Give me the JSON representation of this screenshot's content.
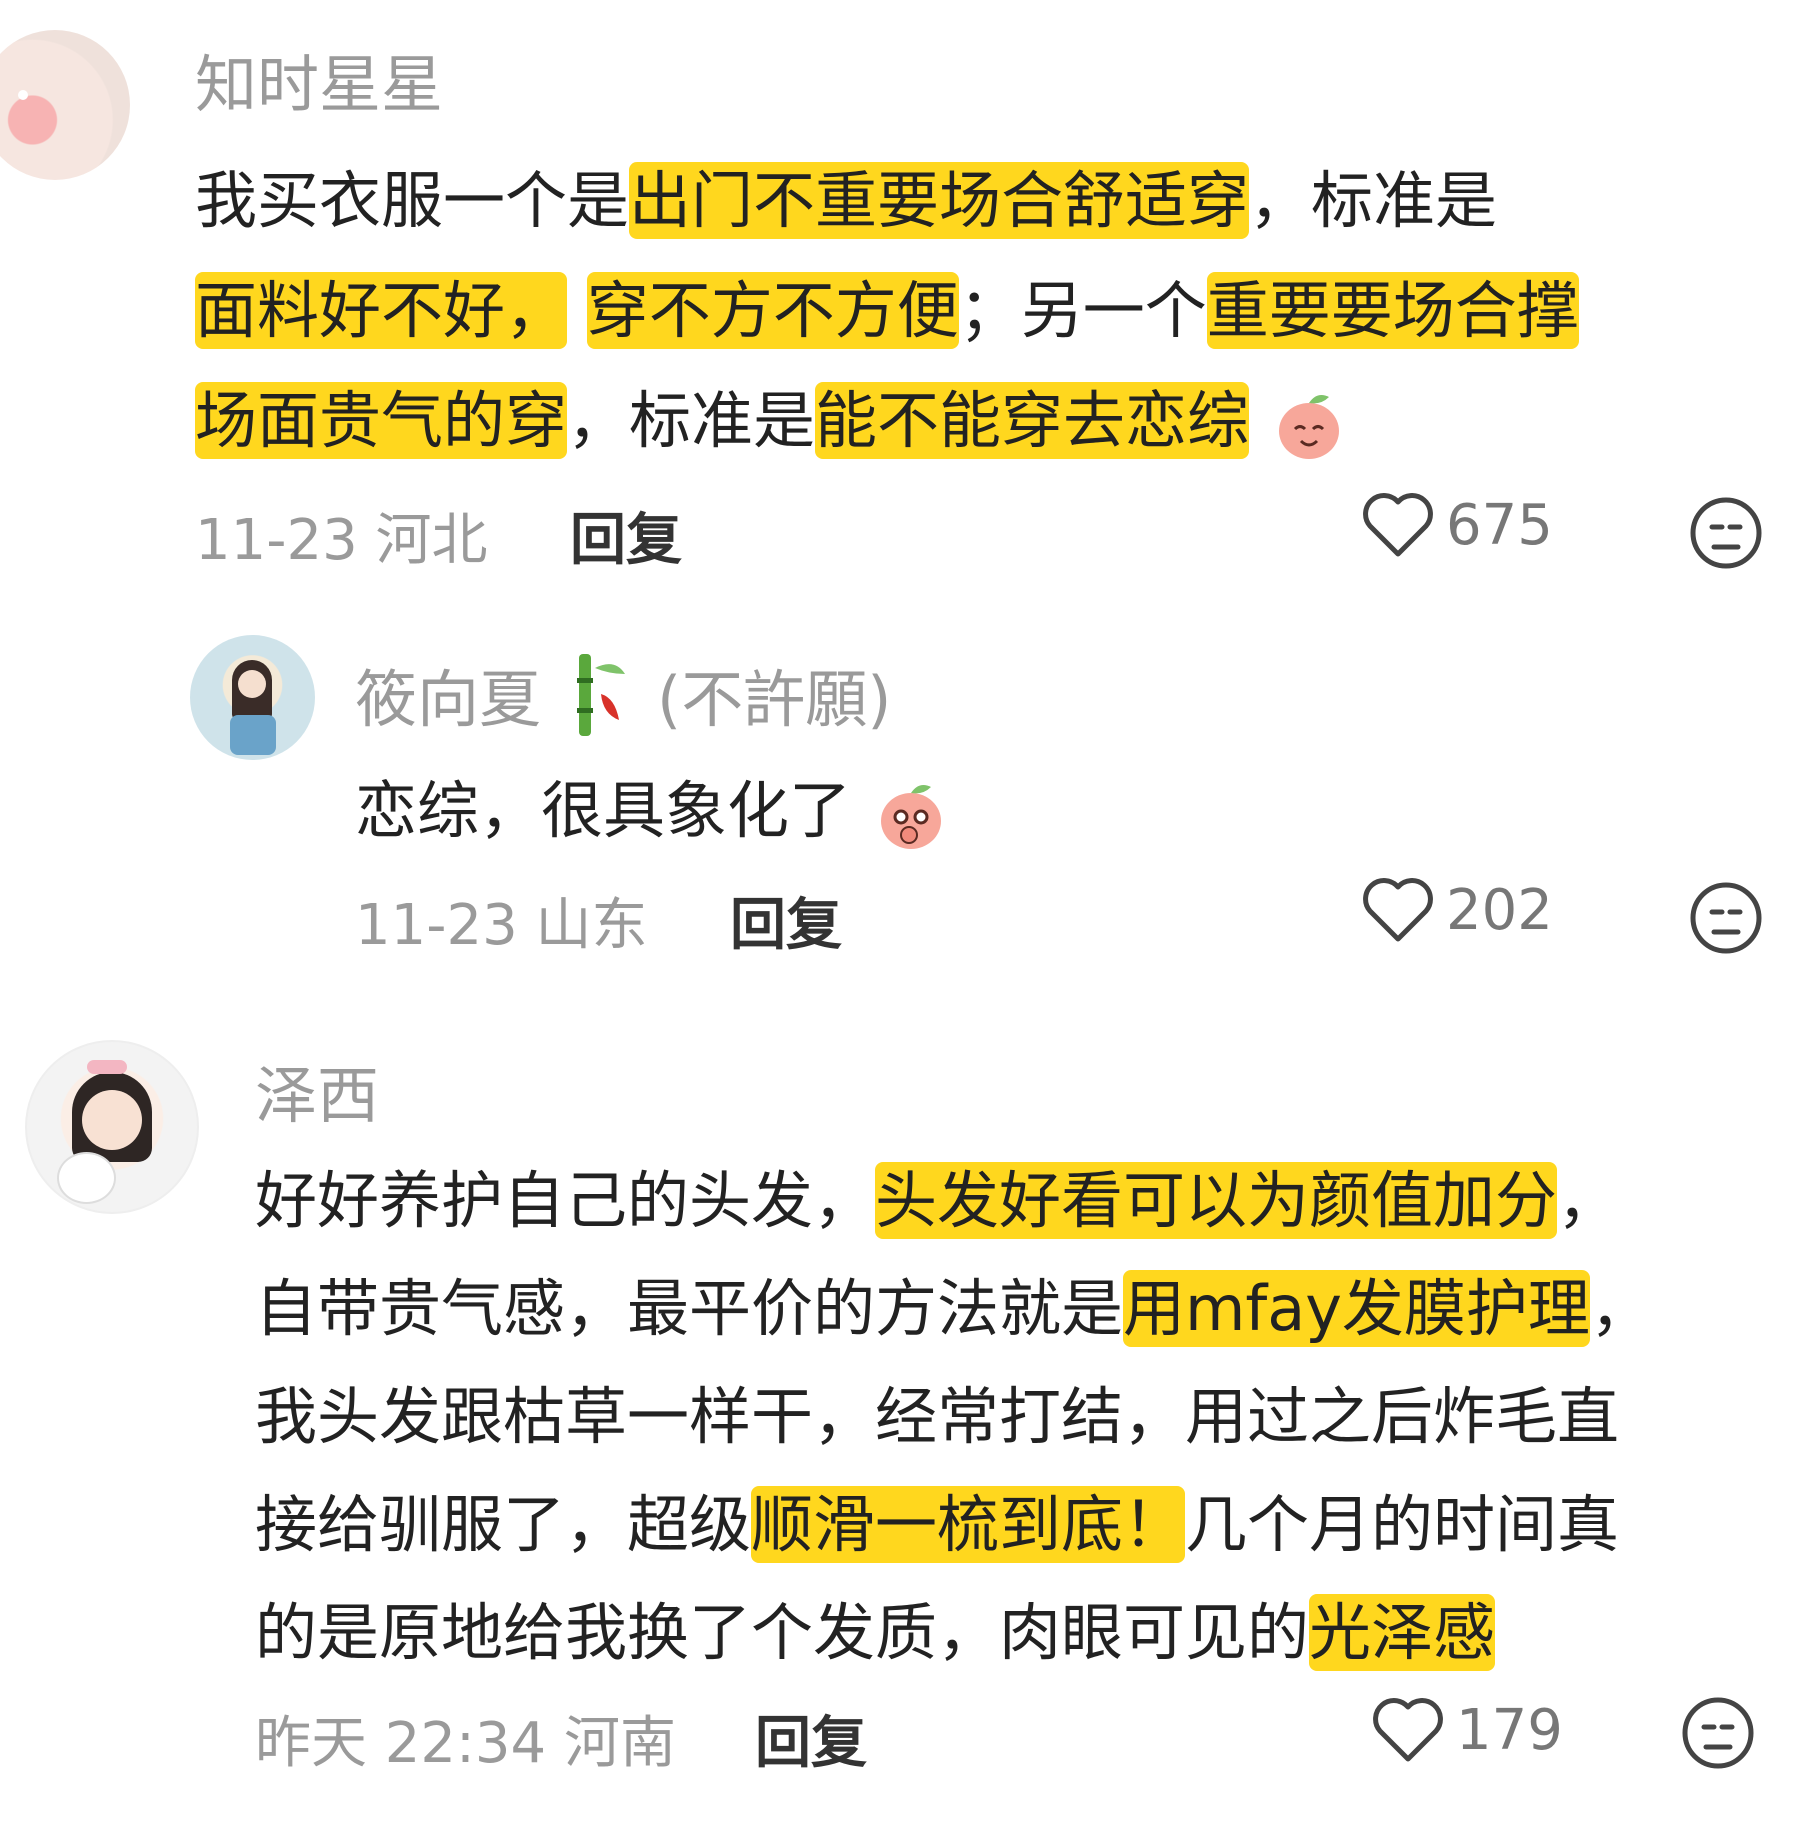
{
  "comments": [
    {
      "username": "知时星星",
      "segments": [
        [
          "我买衣服一个是",
          "出门不重要场合舒适穿",
          "，标准是"
        ],
        [
          "面料好不好，",
          "穿不方不方便",
          "；另一个",
          "重要要场合撑"
        ],
        [
          "场面贵气的穿",
          "，标准是",
          "能不能穿去恋综"
        ]
      ],
      "date": "11-23",
      "location": "河北",
      "reply_label": "回复",
      "likes": "675"
    },
    {
      "username": "筱向夏",
      "username_extra": "(不許願)",
      "text": "恋综，很具象化了",
      "date": "11-23",
      "location": "山东",
      "reply_label": "回复",
      "likes": "202"
    },
    {
      "username": "泽西",
      "segments": [
        [
          "好好养护自己的头发，",
          "头发好看可以为颜值加分",
          "，"
        ],
        [
          "自带贵气感，最平价的方法就是",
          "用mfay发膜护理",
          "，"
        ],
        [
          "我头发跟枯草一样干，经常打结，用过之后炸毛直"
        ],
        [
          "接给驯服了，超级",
          "顺滑一梳到底！",
          "几个月的时间真"
        ],
        [
          "的是原地给我换了个发质，肉眼可见的",
          "光泽感"
        ]
      ],
      "date": "昨天 22:34",
      "location": "河南",
      "reply_label": "回复",
      "likes": "179"
    }
  ],
  "colors": {
    "highlight": "#ffd71e",
    "meta_gray": "#9a9a9a",
    "text": "#222222"
  },
  "icons": [
    "heart-icon",
    "dislike-face-icon",
    "peach-emoji",
    "bamboo-badge-icon"
  ]
}
